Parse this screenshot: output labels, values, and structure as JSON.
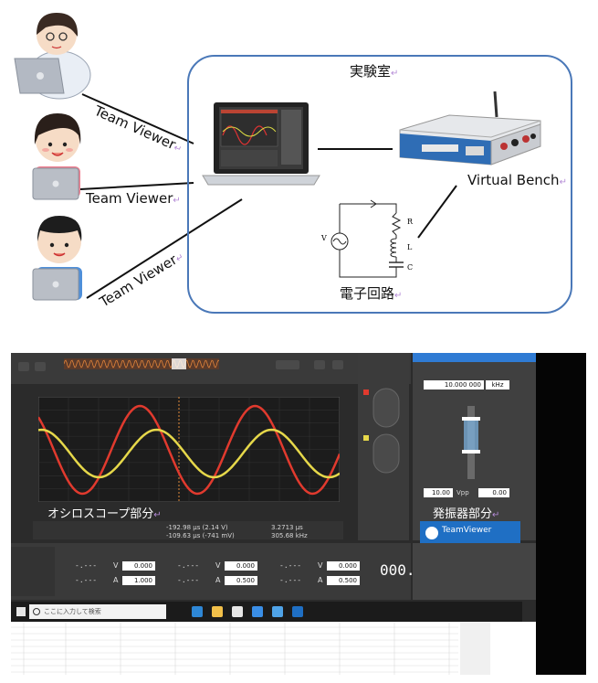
{
  "diagram": {
    "lab_label": "実験室",
    "team_viewer_label": "Team Viewer",
    "virtual_bench_label": "Virtual Bench",
    "circuit_label": "電子回路",
    "circuit_parts": {
      "source": "V",
      "resistor": "R",
      "inductor": "L",
      "capacitor": "C"
    }
  },
  "screenshot": {
    "oscilloscope_label": "オシロスコープ部分",
    "generator_label": "発振器部分",
    "frequency_value": "10.000 000",
    "frequency_unit": "kHz",
    "amplitude_value": "10.00",
    "amplitude_unit": "Vpp",
    "offset_value": "0.00",
    "dc_values": [
      "0.000",
      "1.000",
      "0.000",
      "0.500",
      "0.000",
      "0.500"
    ],
    "dc_units": [
      "V",
      "A",
      "V",
      "A",
      "V",
      "A"
    ],
    "dc_placeholder": "-.---",
    "counter_value": "000.",
    "teamviewer_popup_title": "TeamViewer",
    "search_placeholder": "ここに入力して検索",
    "cursor_readout": [
      "-192.98 μs (2.14 V)",
      "-109.63 μs (-741 mV)"
    ],
    "delta_readout": [
      "3.2713 μs",
      "305.68 kHz"
    ]
  },
  "colors": {
    "lab_border": "#4a78b8",
    "trace_ch1": "#e13a2e",
    "trace_ch2": "#e6d84a",
    "scope_background": "#1c1c1c",
    "teamviewer_blue": "#1f6fc4"
  },
  "icons": [
    "laptop-icon",
    "person-icon",
    "virtual-bench-device-icon",
    "windows-start-icon",
    "search-icon",
    "teamviewer-icon"
  ]
}
